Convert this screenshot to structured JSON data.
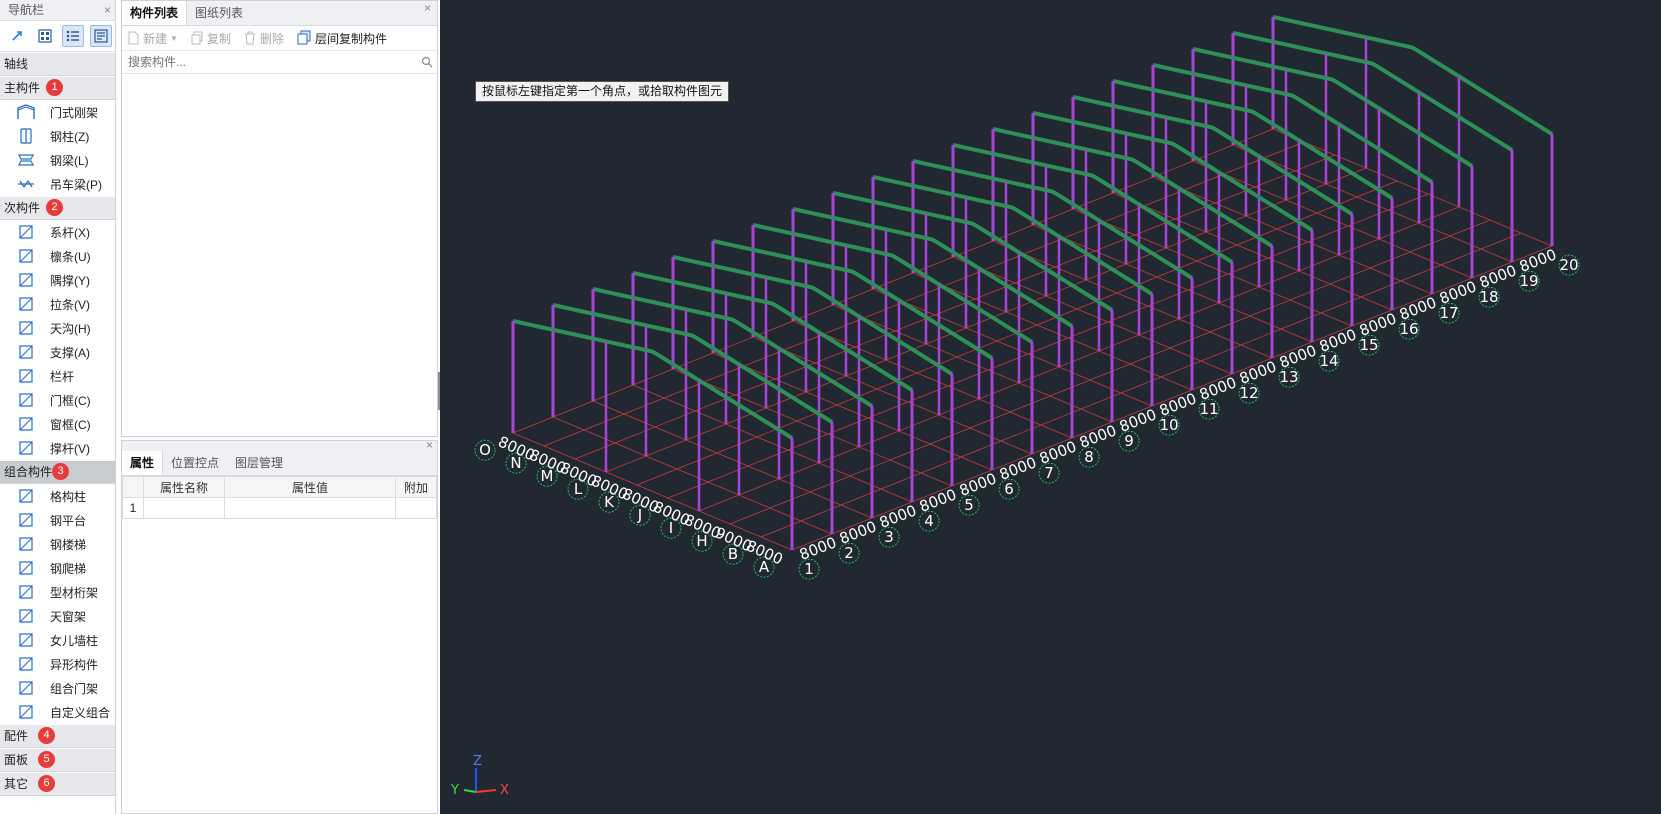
{
  "nav": {
    "title": "导航栏",
    "close": "×",
    "tools": [
      "snap-icon",
      "grid-icon",
      "list-icon",
      "detail-icon"
    ],
    "sections": {
      "axis": {
        "label": "轴线"
      },
      "main": {
        "label": "主构件",
        "badge": "1",
        "items": [
          {
            "label": "门式刚架",
            "icon": "portal-frame-icon"
          },
          {
            "label": "钢柱(Z)",
            "icon": "steel-column-icon"
          },
          {
            "label": "钢梁(L)",
            "icon": "steel-beam-icon"
          },
          {
            "label": "吊车梁(P)",
            "icon": "crane-beam-icon"
          }
        ]
      },
      "secondary": {
        "label": "次构件",
        "badge": "2",
        "items": [
          {
            "label": "系杆(X)",
            "icon": "tie-rod-icon"
          },
          {
            "label": "檩条(U)",
            "icon": "purlin-icon"
          },
          {
            "label": "隅撑(Y)",
            "icon": "knee-brace-icon"
          },
          {
            "label": "拉条(V)",
            "icon": "sag-rod-icon"
          },
          {
            "label": "天沟(H)",
            "icon": "gutter-icon"
          },
          {
            "label": "支撑(A)",
            "icon": "bracing-icon"
          },
          {
            "label": "栏杆",
            "icon": "railing-icon"
          },
          {
            "label": "门框(C)",
            "icon": "door-frame-icon"
          },
          {
            "label": "窗框(C)",
            "icon": "window-frame-icon"
          },
          {
            "label": "撑杆(V)",
            "icon": "strut-icon"
          }
        ]
      },
      "combo": {
        "label": "组合构件",
        "badge": "3",
        "items": [
          {
            "label": "格构柱",
            "icon": "lattice-column-icon"
          },
          {
            "label": "钢平台",
            "icon": "steel-platform-icon"
          },
          {
            "label": "钢楼梯",
            "icon": "steel-stair-icon"
          },
          {
            "label": "钢爬梯",
            "icon": "steel-ladder-icon"
          },
          {
            "label": "型材桁架",
            "icon": "truss-icon"
          },
          {
            "label": "天窗架",
            "icon": "skylight-frame-icon"
          },
          {
            "label": "女儿墙柱",
            "icon": "parapet-column-icon"
          },
          {
            "label": "异形构件",
            "icon": "custom-shape-icon"
          },
          {
            "label": "组合门架",
            "icon": "combo-gate-icon"
          },
          {
            "label": "自定义组合",
            "icon": "custom-combo-icon"
          }
        ]
      },
      "fittings": {
        "label": "配件",
        "badge": "4"
      },
      "panel": {
        "label": "面板",
        "badge": "5"
      },
      "other": {
        "label": "其它",
        "badge": "6"
      }
    }
  },
  "components": {
    "tabs": [
      "构件列表",
      "图纸列表"
    ],
    "toolbar": {
      "new": "新建",
      "copy": "复制",
      "delete": "删除",
      "floor_copy": "层间复制构件"
    },
    "search_placeholder": "搜索构件..."
  },
  "properties": {
    "tabs": [
      "属性",
      "位置控点",
      "图层管理"
    ],
    "columns": [
      "属性名称",
      "属性值",
      "附加"
    ],
    "rows": [
      {
        "index": "1",
        "name": "",
        "value": "",
        "extra": ""
      }
    ]
  },
  "viewport": {
    "tooltip": "按鼠标左键指定第一个角点，或拾取构件图元",
    "axis_triad": {
      "x": "X",
      "y": "Y",
      "z": "Z"
    },
    "grid": {
      "numbers": [
        "1",
        "2",
        "3",
        "4",
        "5",
        "6",
        "7",
        "8",
        "9",
        "10",
        "11",
        "12",
        "13",
        "14",
        "15",
        "16",
        "17",
        "18",
        "19",
        "20"
      ],
      "letters": [
        "A",
        "B",
        "H",
        "I",
        "J",
        "K",
        "L",
        "M",
        "N",
        "O"
      ],
      "spacing_label": "8000",
      "bay_label": "9000"
    },
    "colors": {
      "background": "#222831",
      "grid": "#c83c3c",
      "column": "#a645d8",
      "rafter": "#2e8f58",
      "axis_bubble": "#22c05a",
      "label": "#ffffff"
    }
  }
}
